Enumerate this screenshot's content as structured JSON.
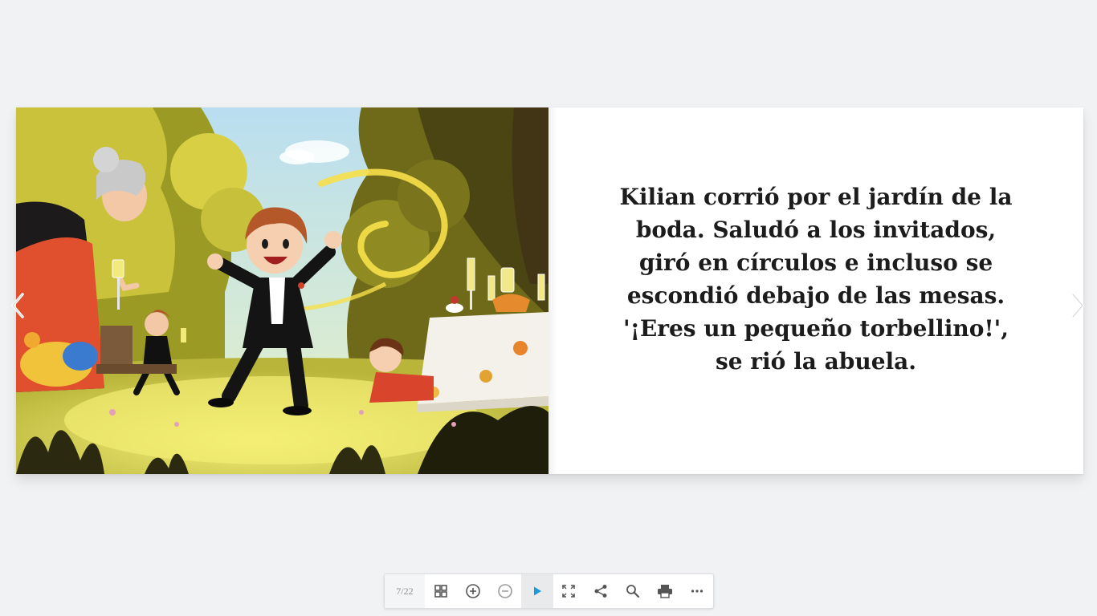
{
  "viewer": {
    "page_counter": "7/22",
    "story_text": "Kilian corrió por el jardín de la boda. Saludó a los invitados, giró en círculos e incluso se escondió debajo de las mesas. '¡Eres un pequeño torbellino!', se rió la abuela.",
    "illustration": "A boy in a tuxedo twirling happily in a sunny wedding garden while his grandmother holds a glass and a girl crawls near a table",
    "accent_color": "#1a9bd7"
  },
  "navigation": {
    "prev_icon": "chevron-left-icon",
    "next_icon": "chevron-right-icon"
  },
  "toolbar": {
    "buttons": [
      {
        "name": "thumbnails-button",
        "icon": "grid-icon"
      },
      {
        "name": "zoom-in-button",
        "icon": "zoom-in-icon"
      },
      {
        "name": "zoom-out-button",
        "icon": "zoom-out-icon"
      },
      {
        "name": "play-button",
        "icon": "play-icon",
        "active": true
      },
      {
        "name": "fullscreen-button",
        "icon": "fullscreen-icon"
      },
      {
        "name": "share-button",
        "icon": "share-icon"
      },
      {
        "name": "search-button",
        "icon": "search-icon"
      },
      {
        "name": "print-button",
        "icon": "print-icon"
      },
      {
        "name": "more-button",
        "icon": "more-icon"
      }
    ]
  }
}
